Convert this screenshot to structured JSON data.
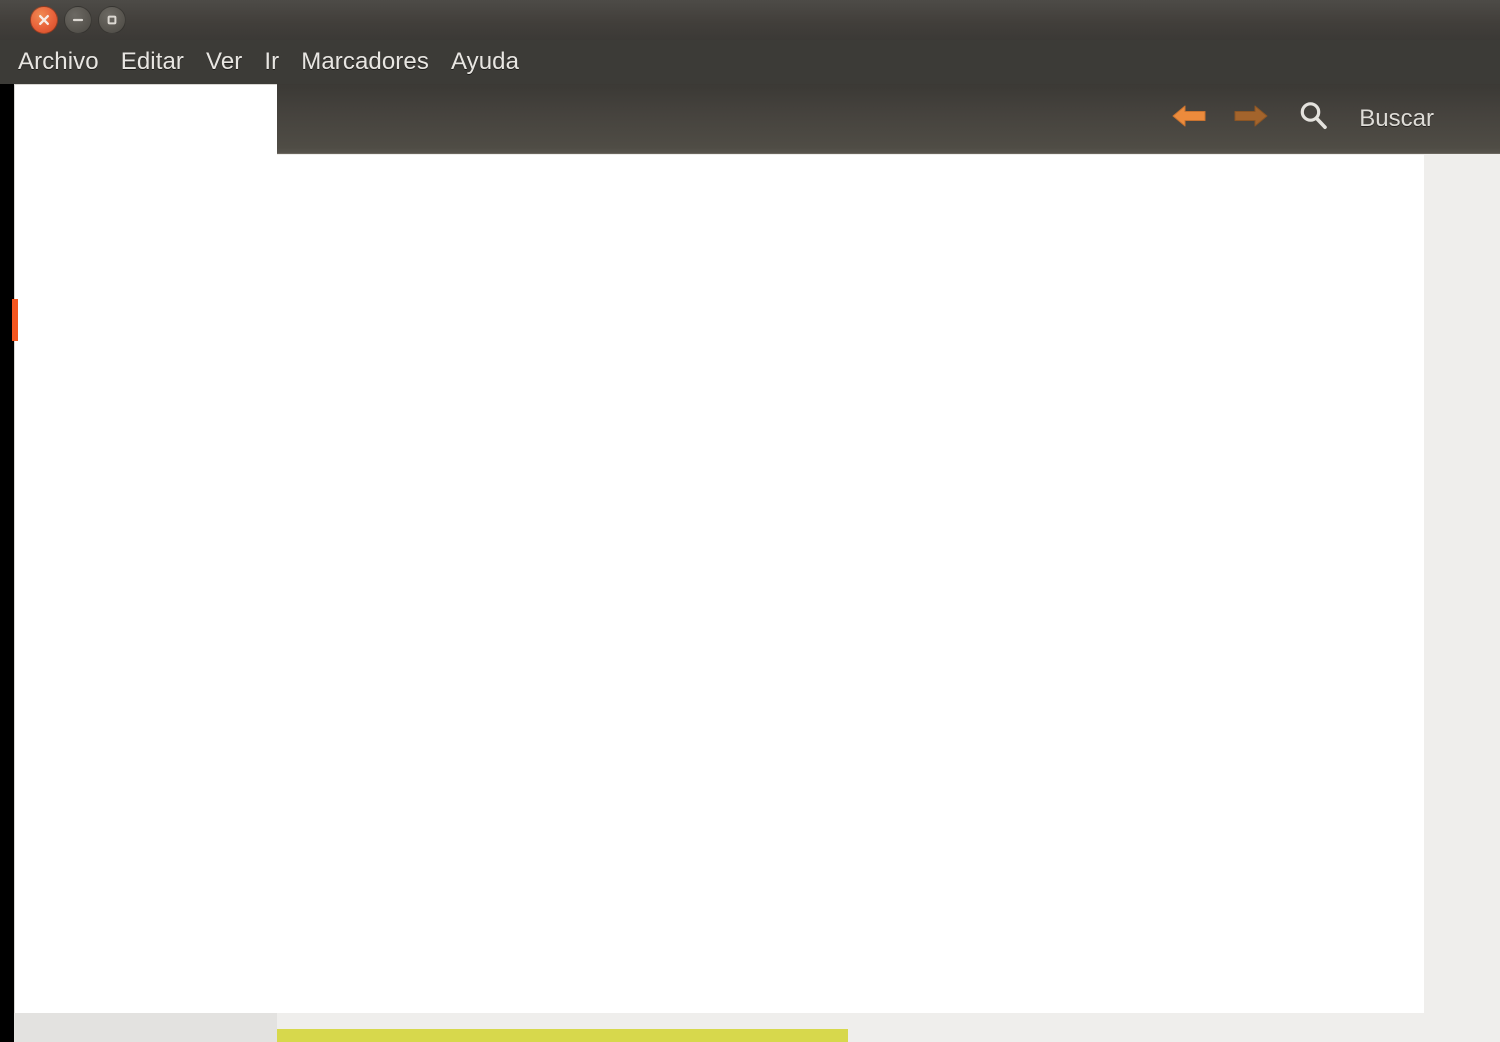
{
  "window": {
    "controls": [
      {
        "name": "close",
        "icon": "close-icon",
        "color": "#e8613a"
      },
      {
        "name": "minimize",
        "icon": "minimize-icon",
        "color": "#5a5751"
      },
      {
        "name": "maximize",
        "icon": "maximize-icon",
        "color": "#5a5751"
      }
    ]
  },
  "menubar": {
    "items": [
      {
        "label": "Archivo"
      },
      {
        "label": "Editar"
      },
      {
        "label": "Ver"
      },
      {
        "label": "Ir"
      },
      {
        "label": "Marcadores"
      },
      {
        "label": "Ayuda"
      }
    ]
  },
  "toolbar": {
    "back": {
      "icon": "arrow-left-icon",
      "color": "#ec8b3c"
    },
    "forward": {
      "icon": "arrow-right-icon",
      "color": "#a3642c"
    },
    "search": {
      "icon": "search-icon",
      "color": "#e2e0dc"
    },
    "search_label": "Buscar"
  },
  "sidebar": {
    "selection_marker_color": "#f4551e"
  },
  "statusbar": {
    "progress_color": "#d7d84c",
    "track_color": "#efeeec"
  },
  "colors": {
    "titlebar_top": "#4d4b47",
    "titlebar_bottom": "#3b3936",
    "menubar": "#3c3b37",
    "toolbar_top": "#3b3935",
    "toolbar_bottom": "#56534c",
    "canvas": "#ffffff",
    "chrome_gray": "#efeeec",
    "sidebar_status": "#e3e2e0",
    "frame": "#000000"
  }
}
